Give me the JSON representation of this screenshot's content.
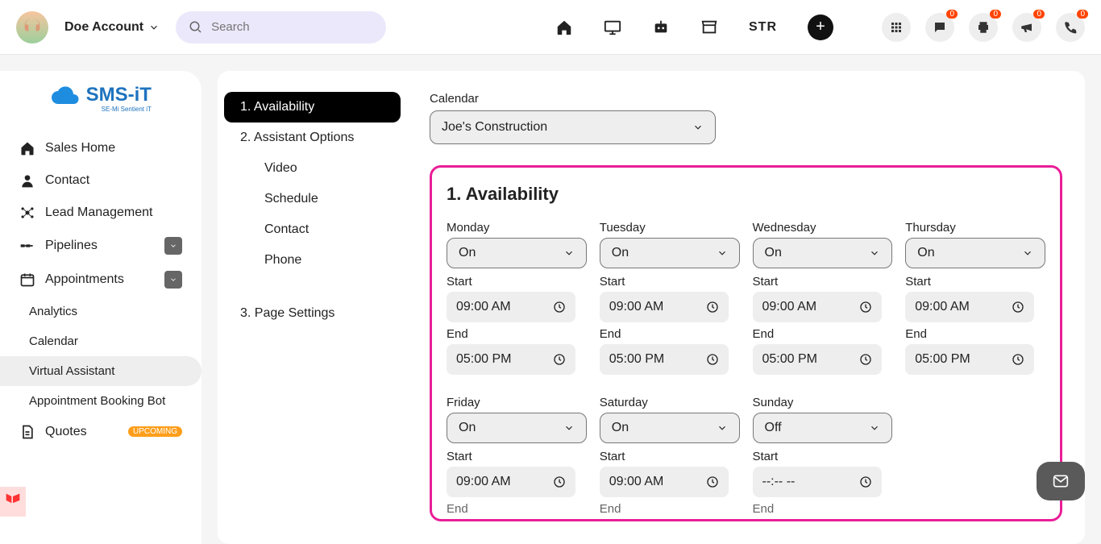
{
  "header": {
    "account_name": "Doe Account",
    "search_placeholder": "Search",
    "str_label": "STR",
    "badges": {
      "chat": "0",
      "print": "0",
      "announce": "0",
      "phone": "0"
    }
  },
  "logo": {
    "brand": "SMS-iT",
    "sub": "SE-Mi Sentient iT"
  },
  "side_nav": {
    "items": [
      {
        "label": "Sales Home"
      },
      {
        "label": "Contact"
      },
      {
        "label": "Lead Management"
      },
      {
        "label": "Pipelines",
        "expand": true
      },
      {
        "label": "Appointments",
        "expand": true
      },
      {
        "label": "Analytics",
        "sub": true
      },
      {
        "label": "Calendar",
        "sub": true
      },
      {
        "label": "Virtual Assistant",
        "sub": true,
        "active": true
      },
      {
        "label": "Appointment Booking Bot",
        "sub": true
      },
      {
        "label": "Quotes",
        "upcoming": true
      }
    ],
    "upcoming_text": "UPCOMING"
  },
  "sub_nav": {
    "items": [
      {
        "label": "1. Availability",
        "sel": true
      },
      {
        "label": "2. Assistant Options"
      },
      {
        "label": "Video",
        "child": true
      },
      {
        "label": "Schedule",
        "child": true
      },
      {
        "label": "Contact",
        "child": true
      },
      {
        "label": "Phone",
        "child": true
      },
      {
        "label": "3. Page Settings"
      }
    ]
  },
  "form": {
    "calendar_label": "Calendar",
    "calendar_value": "Joe's Construction",
    "avail_title": "1. Availability",
    "start_lab": "Start",
    "end_lab": "End",
    "days": [
      {
        "name": "Monday",
        "state": "On",
        "start": "09:00 AM",
        "end": "05:00 PM"
      },
      {
        "name": "Tuesday",
        "state": "On",
        "start": "09:00 AM",
        "end": "05:00 PM"
      },
      {
        "name": "Wednesday",
        "state": "On",
        "start": "09:00 AM",
        "end": "05:00 PM"
      },
      {
        "name": "Thursday",
        "state": "On",
        "start": "09:00 AM",
        "end": "05:00 PM"
      },
      {
        "name": "Friday",
        "state": "On",
        "start": "09:00 AM",
        "end": ""
      },
      {
        "name": "Saturday",
        "state": "On",
        "start": "09:00 AM",
        "end": ""
      },
      {
        "name": "Sunday",
        "state": "Off",
        "start": "--:-- --",
        "end": ""
      }
    ]
  }
}
